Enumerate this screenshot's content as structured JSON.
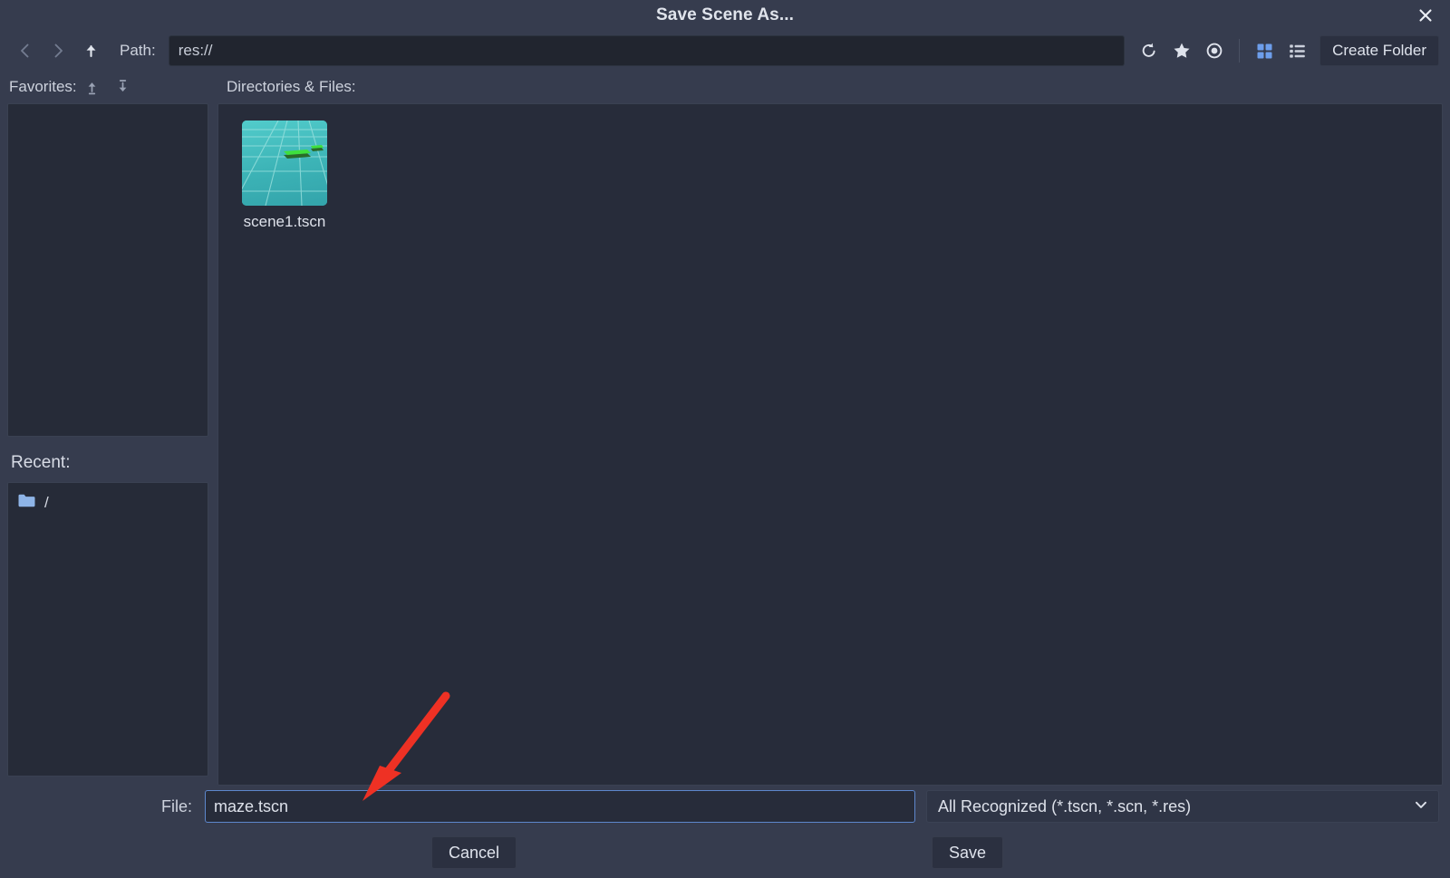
{
  "window": {
    "title": "Save Scene As...",
    "close_icon": "close-icon"
  },
  "toolbar": {
    "back_icon": "chevron-left-icon",
    "forward_icon": "chevron-right-icon",
    "up_icon": "arrow-up-icon",
    "path_label": "Path:",
    "path_value": "res://",
    "refresh_icon": "refresh-icon",
    "favorite_icon": "star-icon",
    "show_hidden_icon": "eye-icon",
    "grid_view_icon": "grid-view-icon",
    "list_view_icon": "list-view-icon",
    "create_folder_label": "Create Folder"
  },
  "sidebar": {
    "favorites_label": "Favorites:",
    "move_up_icon": "move-up-icon",
    "move_down_icon": "move-down-icon",
    "favorites_items": [],
    "recent_label": "Recent:",
    "recent_items": [
      {
        "icon": "folder-icon",
        "name": "/"
      }
    ]
  },
  "files": {
    "header_label": "Directories & Files:",
    "items": [
      {
        "name": "scene1.tscn",
        "thumbnail": "scene-3d-thumbnail"
      }
    ]
  },
  "footer": {
    "file_label": "File:",
    "file_value": "maze.tscn",
    "file_placeholder": "",
    "filter_value": "All Recognized (*.tscn, *.scn, *.res)",
    "filter_chevron_icon": "chevron-down-icon",
    "cancel_label": "Cancel",
    "save_label": "Save"
  },
  "annotation": {
    "arrow_color": "#ee3124",
    "target": "file-input"
  },
  "colors": {
    "chrome": "#363c4e",
    "panel": "#262b38",
    "filelist": "#272c3a",
    "accent_focus": "#5d87cc",
    "accent_active": "#6d9eeb",
    "text": "#dde1ea",
    "thumb_teal": "#3fbdbd",
    "thumb_green": "#3ee03e"
  }
}
